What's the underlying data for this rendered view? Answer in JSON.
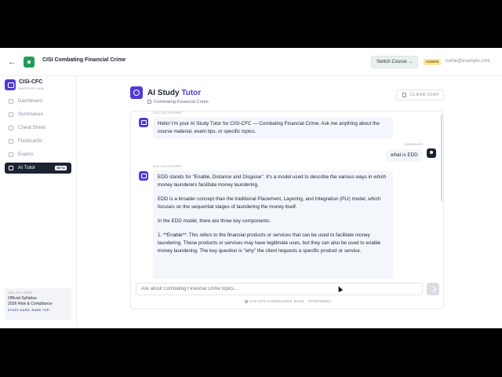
{
  "header": {
    "back_icon": "arrow-left-icon",
    "app_title": "CISI Combating Financial Crime",
    "switch_course": "Switch Course",
    "role_badge": "ADMIN",
    "user_email": "name@example.com",
    "brand_color": "#1f9d57"
  },
  "sidebar": {
    "brand_name": "CISI-CFC",
    "brand_sub": "MASTERY HUB",
    "items": [
      {
        "label": "Dashboard",
        "icon": "grid-icon"
      },
      {
        "label": "Summaries",
        "icon": "document-icon"
      },
      {
        "label": "Cheat Sheet",
        "icon": "list-icon"
      },
      {
        "label": "Flashcards",
        "icon": "cards-icon"
      },
      {
        "label": "Exams",
        "icon": "clipboard-icon"
      },
      {
        "label": "AI Tutor",
        "icon": "chat-icon",
        "badge": "BETA",
        "active": true
      }
    ],
    "prep": {
      "kicker": "CISI-CFC PREP",
      "line1": "Official Syllabus",
      "line2": "2026 Risk & Compliance",
      "tag": "STUDY HARD. RANK TOP."
    }
  },
  "main": {
    "title_a": "AI Study",
    "title_b": "Tutor",
    "subtitle": "Combating Financial Crime",
    "clear_chat": "CLEAR CHAT",
    "accent_color": "#4f3bd6"
  },
  "chat": {
    "messages": [
      {
        "role": "assistant",
        "label": "CISI-CFC EXPERT",
        "paragraphs": [
          "Hello! I'm your AI Study Tutor for CISI-CFC — Combating Financial Crime. Ask me anything about the course material, exam tips, or specific topics."
        ]
      },
      {
        "role": "user",
        "label": "CANDIDATE",
        "text": "what is EDD"
      },
      {
        "role": "assistant",
        "label": "CISI-CFC EXPERT",
        "paragraphs": [
          "EDD stands for \"Enable, Distance and Disguise\". It's a model used to describe the various ways in which money launderers facilitate money laundering.",
          "EDD is a broader concept than the traditional Placement, Layering, and Integration (PLI) model, which focuses on the sequential stages of laundering the money itself.",
          "In the EDD model, there are three key components:",
          "1. **Enable**: This refers to the financial products or services that can be used to facilitate money laundering. These products or services may have legitimate uses, but they can also be used to enable money laundering. The key question is \"why\" the client requests a specific product or service."
        ]
      }
    ],
    "input_placeholder": "Ask about Combating Financial Crime topics...",
    "status": "CISI-CFC KNOWLEDGE BASE · STREAMING"
  }
}
